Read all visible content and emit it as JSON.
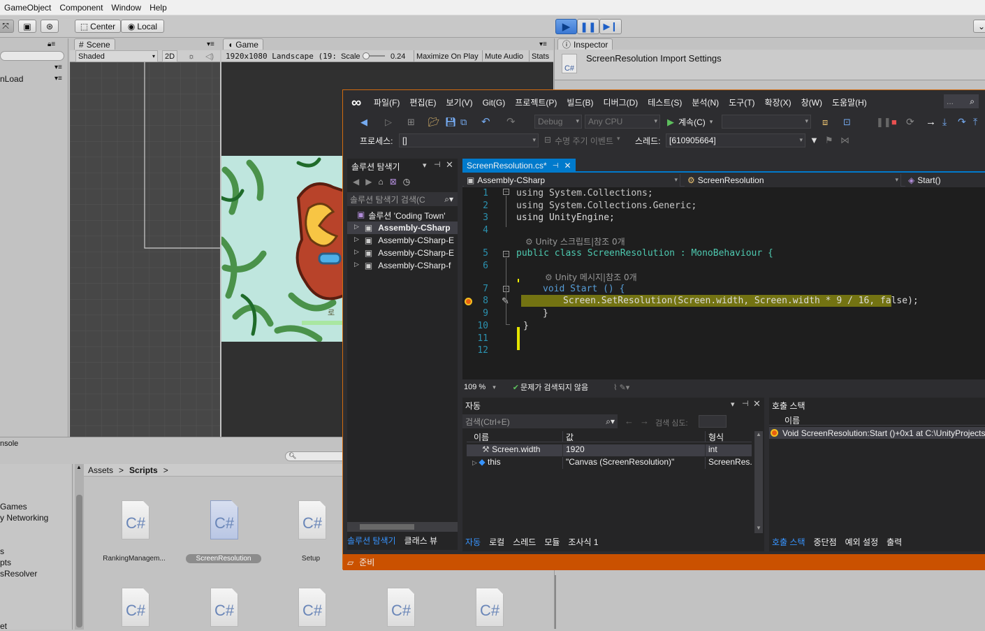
{
  "unity": {
    "menu": [
      "GameObject",
      "Component",
      "Window",
      "Help"
    ],
    "toolbar": {
      "center": "Center",
      "local": "Local"
    },
    "scene": {
      "tab": "Scene",
      "shading": "Shaded",
      "mode2d": "2D"
    },
    "game": {
      "tab": "Game",
      "resolution": "1920x1080 Landscape (19:",
      "scale_label": "Scale",
      "scale_value": "0.24",
      "maximize": "Maximize On Play",
      "mute": "Mute Audio",
      "stats": "Stats"
    },
    "inspector": {
      "tab": "Inspector",
      "title": "ScreenResolution Import Settings",
      "icon_text": "C#"
    },
    "hierarchy": {
      "item": "nLoad"
    },
    "console": {
      "tab": "nsole"
    },
    "breadcrumb": {
      "root": "Assets",
      "sep": ">",
      "current": "Scripts"
    },
    "left_items": [
      "Games",
      "y Networking",
      "s",
      "pts",
      "sResolver",
      "et"
    ],
    "assets_icon_text": "C#",
    "assets_row1": [
      "RankingManagem...",
      "ScreenResolution",
      "Setup"
    ]
  },
  "vs": {
    "menu": [
      "파일(F)",
      "편집(E)",
      "보기(V)",
      "Git(G)",
      "프로젝트(P)",
      "빌드(B)",
      "디버그(D)",
      "테스트(S)",
      "분석(N)",
      "도구(T)",
      "확장(X)",
      "창(W)",
      "도움말(H)"
    ],
    "search": "...",
    "config": "Debug",
    "platform": "Any CPU",
    "continue": "계속(C)",
    "process_label": "프로세스:",
    "process_value": "[]",
    "lifecycle": "수명 주기 이벤트",
    "thread_label": "스레드:",
    "thread_value": "[610905664]",
    "solution": {
      "title": "솔루션 탐색기",
      "search": "솔루션 탐색기 검색(C",
      "root": "솔루션 'Coding Town'",
      "items": [
        "Assembly-CSharp",
        "Assembly-CSharp-E",
        "Assembly-CSharp-E",
        "Assembly-CSharp-f"
      ],
      "bottom_tabs": [
        "솔루션 탐색기",
        "클래스 뷰"
      ]
    },
    "editor": {
      "tab": "ScreenResolution.cs*",
      "nav_project": "Assembly-CSharp",
      "nav_class": "ScreenResolution",
      "nav_member": "Start()",
      "lines": [
        {
          "n": "1",
          "code": "using System.Collections;"
        },
        {
          "n": "2",
          "code": "using System.Collections.Generic;"
        },
        {
          "n": "3",
          "code": "using UnityEngine;"
        },
        {
          "n": "4",
          "code": ""
        },
        {
          "n": "",
          "code": "Unity 스크립트|참조 0개"
        },
        {
          "n": "5",
          "code": "public class ScreenResolution : MonoBehaviour {"
        },
        {
          "n": "6",
          "code": ""
        },
        {
          "n": "",
          "code": "Unity 메시지|참조 0개"
        },
        {
          "n": "7",
          "code": "void Start () {"
        },
        {
          "n": "8",
          "code": "Screen.SetResolution(Screen.width, Screen.width * 9 / 16, false);"
        },
        {
          "n": "9",
          "code": "}"
        },
        {
          "n": "10",
          "code": "}"
        },
        {
          "n": "11",
          "code": ""
        },
        {
          "n": "12",
          "code": ""
        }
      ],
      "zoom": "109 %",
      "issues": "문제가 검색되지 않음"
    },
    "autos": {
      "title": "자동",
      "search": "검색(Ctrl+E)",
      "depth": "검색 심도:",
      "headers": [
        "이름",
        "값",
        "형식"
      ],
      "rows": [
        {
          "name": "Screen.width",
          "value": "1920",
          "type": "int"
        },
        {
          "name": "this",
          "value": "\"Canvas (ScreenResolution)\"",
          "type": "ScreenRes..."
        }
      ],
      "bottom_tabs": [
        "자동",
        "로컬",
        "스레드",
        "모듈",
        "조사식 1"
      ]
    },
    "callstack": {
      "title": "호출 스택",
      "header": "이름",
      "row": "Void ScreenResolution:Start ()+0x1 at C:\\UnityProjects\\",
      "bottom_tabs": [
        "호출 스택",
        "중단점",
        "예외 설정",
        "출력"
      ]
    },
    "status": "준비"
  }
}
